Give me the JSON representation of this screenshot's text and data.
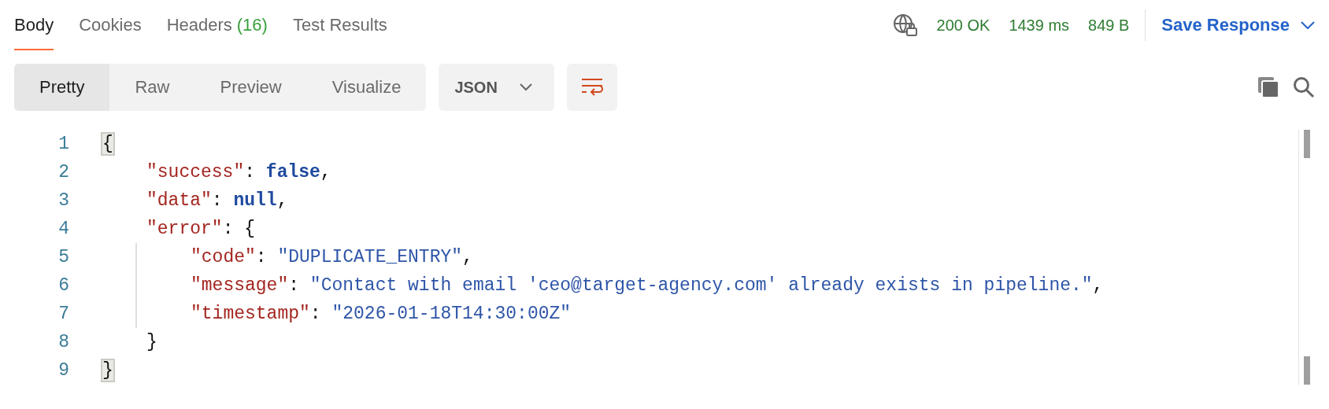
{
  "tabs": [
    {
      "label": "Body",
      "selected": true
    },
    {
      "label": "Cookies",
      "selected": false
    },
    {
      "label": "Headers",
      "count": "(16)",
      "selected": false
    },
    {
      "label": "Test Results",
      "selected": false
    }
  ],
  "status": {
    "code": "200 OK",
    "time": "1439 ms",
    "size": "849 B"
  },
  "save_button": {
    "label": "Save Response"
  },
  "view_modes": [
    {
      "label": "Pretty",
      "selected": true
    },
    {
      "label": "Raw",
      "selected": false
    },
    {
      "label": "Preview",
      "selected": false
    },
    {
      "label": "Visualize",
      "selected": false
    }
  ],
  "format_dropdown": {
    "value": "JSON"
  },
  "code": {
    "lines": [
      {
        "number": "1",
        "tokens": [
          {
            "kind": "punct",
            "text": "{",
            "matched": true
          }
        ],
        "children": [
          {
            "number": "2",
            "tokens": [
              {
                "kind": "key",
                "text": "\"success\"",
                "matched": false
              },
              {
                "kind": "punct",
                "text": ": ",
                "matched": false
              },
              {
                "kind": "keyword",
                "text": "false",
                "matched": false
              },
              {
                "kind": "punct",
                "text": ",",
                "matched": false
              }
            ]
          },
          {
            "number": "3",
            "tokens": [
              {
                "kind": "key",
                "text": "\"data\"",
                "matched": false
              },
              {
                "kind": "punct",
                "text": ": ",
                "matched": false
              },
              {
                "kind": "keyword",
                "text": "null",
                "matched": false
              },
              {
                "kind": "punct",
                "text": ",",
                "matched": false
              }
            ]
          },
          {
            "number": "4",
            "tokens": [
              {
                "kind": "key",
                "text": "\"error\"",
                "matched": false
              },
              {
                "kind": "punct",
                "text": ": {",
                "matched": false
              }
            ],
            "children": [
              {
                "number": "5",
                "tokens": [
                  {
                    "kind": "key",
                    "text": "\"code\"",
                    "matched": false
                  },
                  {
                    "kind": "punct",
                    "text": ": ",
                    "matched": false
                  },
                  {
                    "kind": "string",
                    "text": "\"DUPLICATE_ENTRY\"",
                    "matched": false
                  },
                  {
                    "kind": "punct",
                    "text": ",",
                    "matched": false
                  }
                ]
              },
              {
                "number": "6",
                "tokens": [
                  {
                    "kind": "key",
                    "text": "\"message\"",
                    "matched": false
                  },
                  {
                    "kind": "punct",
                    "text": ": ",
                    "matched": false
                  },
                  {
                    "kind": "string",
                    "text": "\"Contact with email 'ceo@target-agency.com' already exists in pipeline.\"",
                    "matched": false
                  },
                  {
                    "kind": "punct",
                    "text": ",",
                    "matched": false
                  }
                ]
              },
              {
                "number": "7",
                "tokens": [
                  {
                    "kind": "key",
                    "text": "\"timestamp\"",
                    "matched": false
                  },
                  {
                    "kind": "punct",
                    "text": ": ",
                    "matched": false
                  },
                  {
                    "kind": "string",
                    "text": "\"2026-01-18T14:30:00Z\"",
                    "matched": false
                  }
                ]
              }
            ]
          },
          {
            "number": "8",
            "tokens": [
              {
                "kind": "punct",
                "text": "}",
                "matched": false
              }
            ]
          }
        ]
      },
      {
        "number": "9",
        "tokens": [
          {
            "kind": "punct",
            "text": "}",
            "matched": true
          }
        ]
      }
    ]
  }
}
